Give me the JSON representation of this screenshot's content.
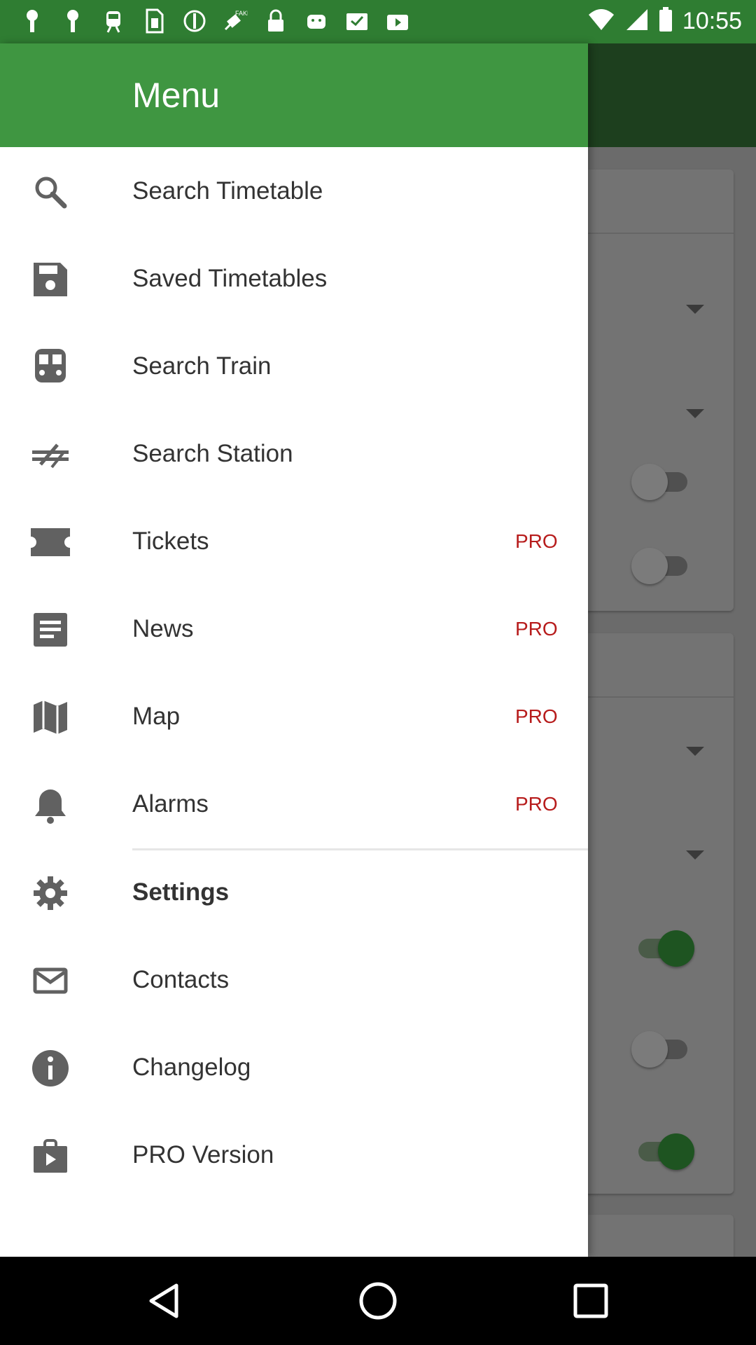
{
  "status_bar": {
    "time": "10:55",
    "icons": [
      "pin-icon",
      "pin-icon",
      "train-icon",
      "sim-icon",
      "block-icon",
      "fake-gps-icon",
      "lock-icon",
      "android-icon",
      "inbox-icon",
      "youtube-icon",
      "wifi-icon",
      "signal-icon",
      "battery-icon"
    ]
  },
  "drawer": {
    "title": "Menu",
    "items": [
      {
        "label": "Search Timetable",
        "icon": "search-icon"
      },
      {
        "label": "Saved Timetables",
        "icon": "save-icon"
      },
      {
        "label": "Search Train",
        "icon": "train-icon"
      },
      {
        "label": "Search Station",
        "icon": "station-icon"
      },
      {
        "label": "Tickets",
        "icon": "ticket-icon",
        "badge": "PRO"
      },
      {
        "label": "News",
        "icon": "news-icon",
        "badge": "PRO"
      },
      {
        "label": "Map",
        "icon": "map-icon",
        "badge": "PRO"
      },
      {
        "label": "Alarms",
        "icon": "bell-icon",
        "badge": "PRO"
      },
      {
        "label": "Settings",
        "icon": "gear-icon",
        "selected": true
      },
      {
        "label": "Contacts",
        "icon": "mail-icon"
      },
      {
        "label": "Changelog",
        "icon": "info-icon"
      },
      {
        "label": "PRO Version",
        "icon": "shop-icon"
      }
    ]
  },
  "background": {
    "toggles": [
      false,
      false,
      true,
      false,
      true
    ]
  },
  "navbar": {
    "buttons": [
      "back-icon",
      "home-icon",
      "recents-icon"
    ]
  },
  "colors": {
    "header_green": "#3f9641",
    "status_green": "#2f7d32",
    "pro_red": "#b71c1c",
    "toggle_on": "#1e5421"
  }
}
